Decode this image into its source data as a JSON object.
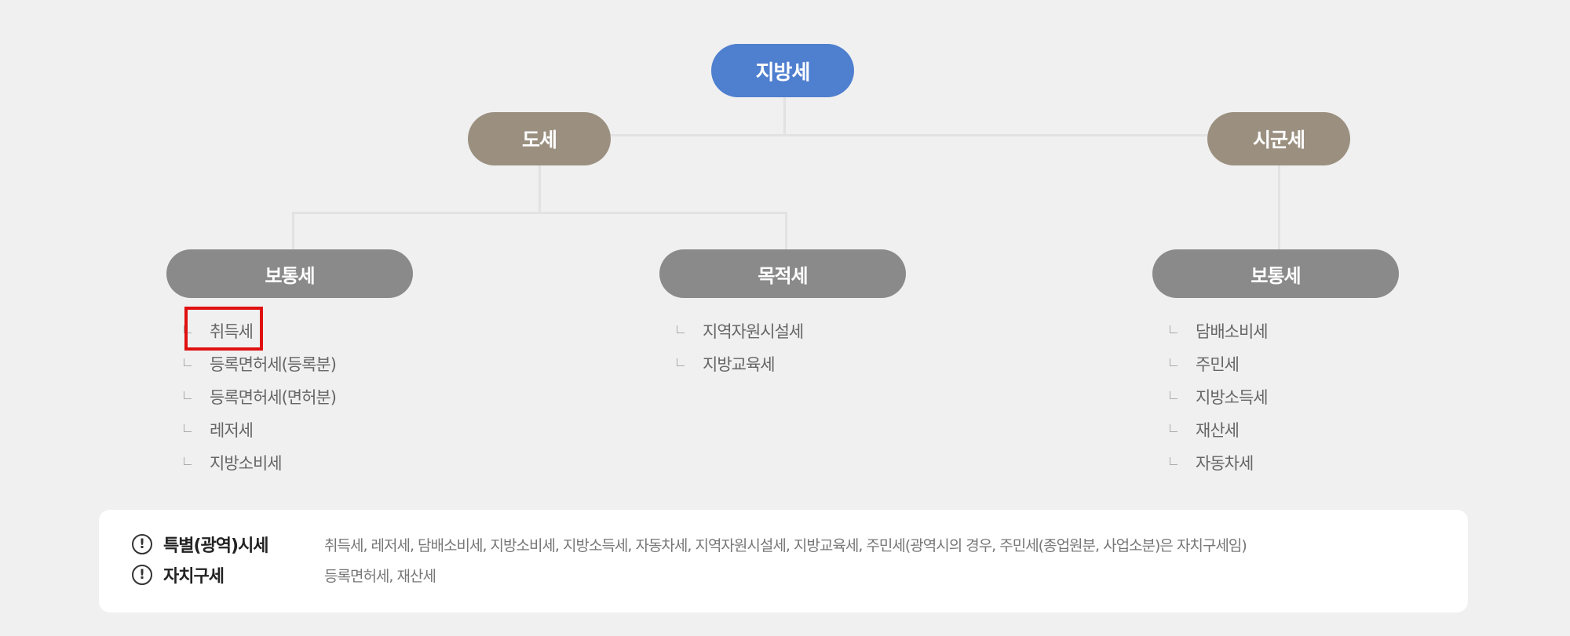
{
  "root": {
    "label": "지방세"
  },
  "do_tax": {
    "label": "도세",
    "children": [
      {
        "label": "보통세",
        "items": [
          "취득세",
          "등록면허세(등록분)",
          "등록면허세(면허분)",
          "레저세",
          "지방소비세"
        ]
      },
      {
        "label": "목적세",
        "items": [
          "지역자원시설세",
          "지방교육세"
        ]
      }
    ]
  },
  "sigun_tax": {
    "label": "시군세",
    "children": [
      {
        "label": "보통세",
        "items": [
          "담배소비세",
          "주민세",
          "지방소득세",
          "재산세",
          "자동차세"
        ]
      }
    ]
  },
  "highlighted_item": "취득세",
  "highlight_color": "#e01010",
  "colors": {
    "root": "#4f7fcf",
    "level1": "#9b9080",
    "level2": "#8a8a8a"
  },
  "info": [
    {
      "icon": "exclamation-circle-icon",
      "mark": "!",
      "title": "특별(광역)시세",
      "desc": "취득세, 레저세, 담배소비세, 지방소비세, 지방소득세, 자동차세, 지역자원시설세, 지방교육세, 주민세(광역시의 경우, 주민세(종업원분, 사업소분)은 자치구세임)"
    },
    {
      "icon": "exclamation-circle-icon",
      "mark": "!",
      "title": "자치구세",
      "desc": "등록면허세, 재산세"
    }
  ]
}
